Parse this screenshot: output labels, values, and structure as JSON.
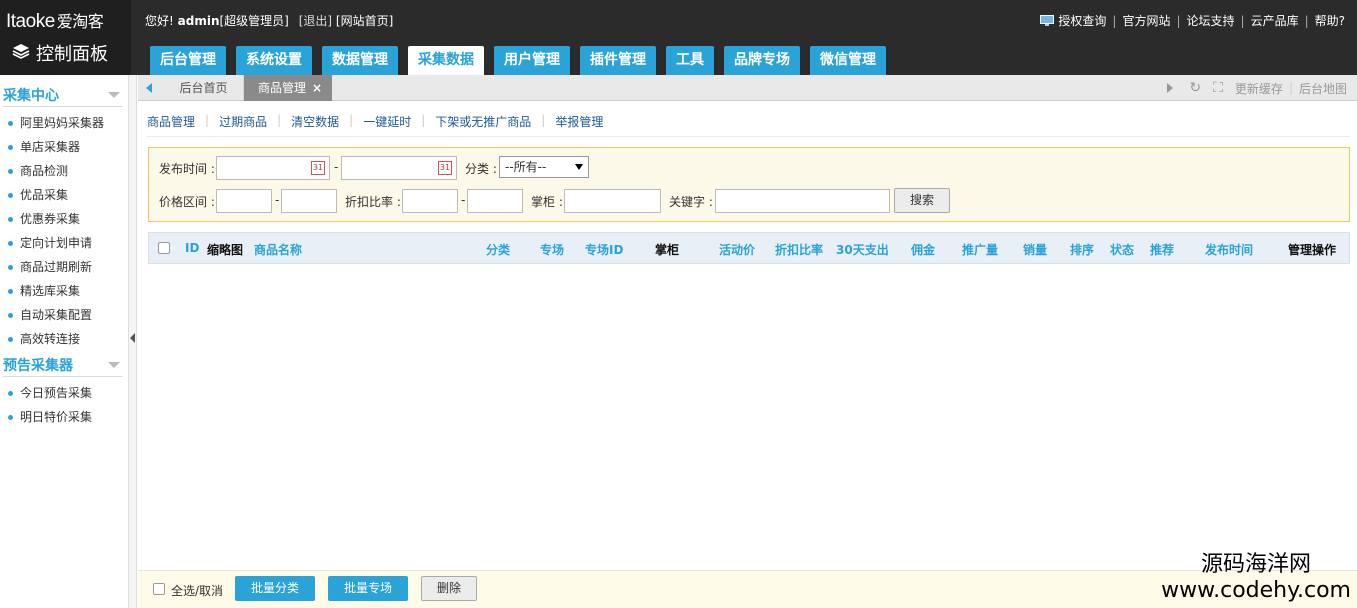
{
  "header": {
    "brand": "Itaoke",
    "brand_cn": "爱淘客",
    "panel_title": "控制面板",
    "welcome_prefix": "您好!",
    "username": "admin",
    "role": "[超级管理员]",
    "logout": "[退出]",
    "site_home": "[网站首页]",
    "top_links": [
      "授权查询",
      "官方网站",
      "论坛支持",
      "云产品库",
      "帮助?"
    ]
  },
  "nav": {
    "tabs": [
      "后台管理",
      "系统设置",
      "数据管理",
      "采集数据",
      "用户管理",
      "插件管理",
      "工具",
      "品牌专场",
      "微信管理"
    ],
    "active_index": 3
  },
  "sidebar": {
    "groups": [
      {
        "title": "采集中心",
        "items": [
          "阿里妈妈采集器",
          "单店采集器",
          "商品检测",
          "优品采集",
          "优惠券采集",
          "定向计划申请",
          "商品过期刷新",
          "精选库采集",
          "自动采集配置",
          "高效转连接"
        ]
      },
      {
        "title": "预告采集器",
        "items": [
          "今日预告采集",
          "明日特价采集"
        ]
      }
    ]
  },
  "tabstrip": {
    "home": "后台首页",
    "current": "商品管理",
    "close": "×",
    "refresh_cache": "更新缓存",
    "site_map": "后台地图"
  },
  "subnav": [
    "商品管理",
    "过期商品",
    "清空数据",
    "一键延时",
    "下架或无推广商品",
    "举报管理"
  ],
  "filter": {
    "publish_time_label": "发布时间 :",
    "dash": "-",
    "category_label": "分类 :",
    "category_value": "--所有--",
    "price_range_label": "价格区间 :",
    "discount_label": "折扣比率 :",
    "shop_label": "掌柜 :",
    "keyword_label": "关键字 :",
    "search_button": "搜索",
    "calendar_glyph": "31"
  },
  "table": {
    "columns": [
      "ID",
      "缩略图",
      "商品名称",
      "分类",
      "专场",
      "专场ID",
      "掌柜",
      "活动价",
      "折扣比率",
      "30天支出",
      "佣金",
      "推广量",
      "销量",
      "排序",
      "状态",
      "推荐",
      "发布时间",
      "管理操作"
    ]
  },
  "bottom": {
    "select_all": "全选/取消",
    "batch_category": "批量分类",
    "batch_special": "批量专场",
    "delete": "删除"
  },
  "watermark": {
    "line1": "源码海洋网",
    "line2": "www.codehy.com"
  },
  "colors": {
    "accent": "#2aa3d8",
    "header_bg": "#2b2b2b",
    "filter_bg": "#fdf9e8",
    "filter_border": "#f0c36d"
  }
}
